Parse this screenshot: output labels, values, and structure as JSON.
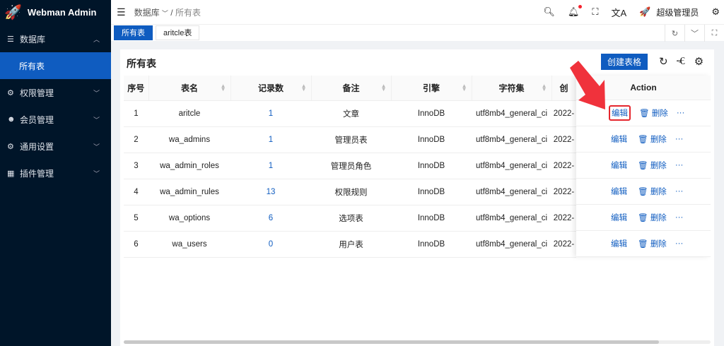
{
  "app": {
    "title": "Webman Admin",
    "logo_icon": "rocket-icon"
  },
  "sidebar": {
    "items": [
      {
        "label": "数据库",
        "icon": "database-icon",
        "expanded": true
      },
      {
        "label": "所有表",
        "active": true
      },
      {
        "label": "权限管理",
        "icon": "gear-icon"
      },
      {
        "label": "会员管理",
        "icon": "user-icon"
      },
      {
        "label": "通用设置",
        "icon": "gear-icon"
      },
      {
        "label": "插件管理",
        "icon": "grid-icon"
      }
    ]
  },
  "header": {
    "breadcrumb": [
      "数据库",
      "所有表"
    ],
    "user": "超级管理员",
    "notification_dot_color": "#f5222d"
  },
  "tabs": [
    {
      "label": "所有表",
      "active": true
    },
    {
      "label": "aritcle表"
    }
  ],
  "card": {
    "title": "所有表",
    "create_button": "创建表格"
  },
  "table": {
    "columns": [
      "序号",
      "表名",
      "记录数",
      "备注",
      "引擎",
      "字符集",
      "创"
    ],
    "action_header": "Action",
    "rows": [
      [
        "1",
        "aritcle",
        "1",
        "文章",
        "InnoDB",
        "utf8mb4_general_ci",
        "2022-"
      ],
      [
        "2",
        "wa_admins",
        "1",
        "管理员表",
        "InnoDB",
        "utf8mb4_general_ci",
        "2022-"
      ],
      [
        "3",
        "wa_admin_roles",
        "1",
        "管理员角色",
        "InnoDB",
        "utf8mb4_general_ci",
        "2022-"
      ],
      [
        "4",
        "wa_admin_rules",
        "13",
        "权限规则",
        "InnoDB",
        "utf8mb4_general_ci",
        "2022-"
      ],
      [
        "5",
        "wa_options",
        "6",
        "选项表",
        "InnoDB",
        "utf8mb4_general_ci",
        "2022-"
      ],
      [
        "6",
        "wa_users",
        "0",
        "用户表",
        "InnoDB",
        "utf8mb4_general_ci",
        "2022-"
      ]
    ],
    "actions": {
      "edit": "编辑",
      "delete": "删除",
      "more": "···"
    }
  },
  "colors": {
    "accent": "#0f5cc0",
    "sidebar": "#001529",
    "highlight": "#e5262d"
  }
}
